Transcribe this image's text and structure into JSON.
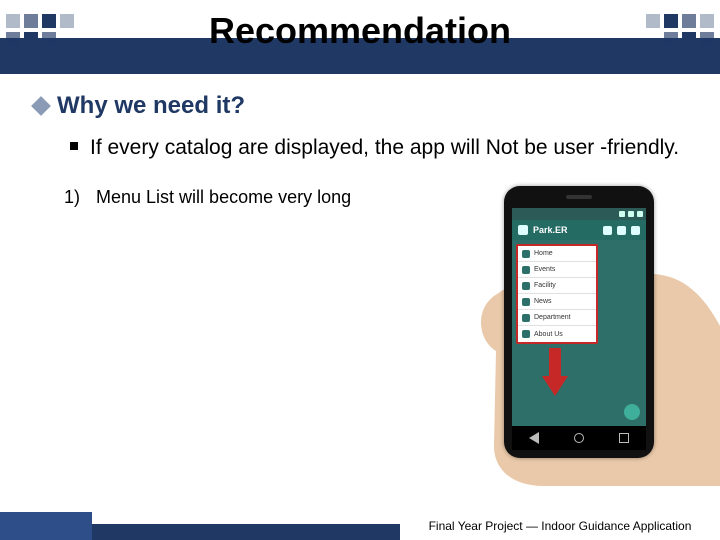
{
  "title": "Recommendation",
  "section_heading": "Why we need it?",
  "bullet_text": "If every catalog are displayed, the app will Not be user -friendly.",
  "numbered": {
    "index": "1)",
    "text": "Menu List will become very long"
  },
  "phone": {
    "app_title": "Park.ER",
    "menu_items": [
      "Home",
      "Events",
      "Facility",
      "News",
      "Department",
      "About Us"
    ]
  },
  "footer": "Final Year Project — Indoor Guidance Application",
  "colors": {
    "brand": "#1f3864",
    "accent": "#2e4e8a",
    "danger": "#c62828",
    "app": "#246b64"
  }
}
